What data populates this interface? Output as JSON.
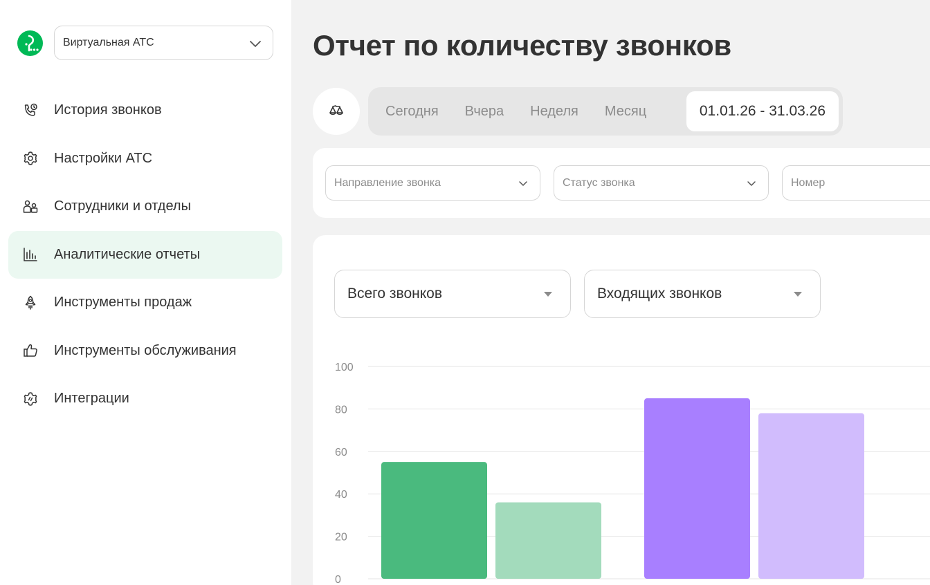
{
  "sidebar": {
    "logo": {
      "icon": "megafon-logo-icon",
      "color": "#00b956"
    },
    "product_select": {
      "value": "Виртуальная АТС",
      "icon": "chevron-down-icon"
    },
    "items": [
      {
        "label": "История звонков",
        "icon": "phone-clock-icon",
        "active": false
      },
      {
        "label": "Настройки АТС",
        "icon": "gear-icon",
        "active": false
      },
      {
        "label": "Сотрудники и отделы",
        "icon": "people-icon",
        "active": false
      },
      {
        "label": "Аналитические отчеты",
        "icon": "bar-chart-icon",
        "active": true
      },
      {
        "label": "Инструменты продаж",
        "icon": "rocket-icon",
        "active": false
      },
      {
        "label": "Инструменты обслуживания",
        "icon": "thumbs-up-icon",
        "active": false
      },
      {
        "label": "Интеграции",
        "icon": "integration-gear-icon",
        "active": false
      }
    ]
  },
  "header": {
    "title": "Отчет по количеству звонков"
  },
  "period": {
    "filter_icon": "scales-icon",
    "tabs": [
      "Сегодня",
      "Вчера",
      "Неделя",
      "Месяц"
    ],
    "active_range": "01.01.26 - 31.03.26"
  },
  "filters": {
    "direction_placeholder": "Направление звонка",
    "status_placeholder": "Статус звонка",
    "number_placeholder": "Номер"
  },
  "metrics": {
    "first": "Всего звонков",
    "second": "Входящих звонков"
  },
  "colors": {
    "accent": "#00b956",
    "active_nav_bg": "#ebf8f1",
    "bar_green": "#4aba7e",
    "bar_green_light": "#a3dbbc",
    "bar_purple": "#a87fff",
    "bar_purple_light": "#d1bcfd"
  },
  "chart_data": {
    "type": "bar",
    "ylim": [
      0,
      100
    ],
    "yticks": [
      0,
      20,
      40,
      60,
      80,
      100
    ],
    "grid": true,
    "values": [
      55,
      36,
      85,
      78
    ]
  }
}
